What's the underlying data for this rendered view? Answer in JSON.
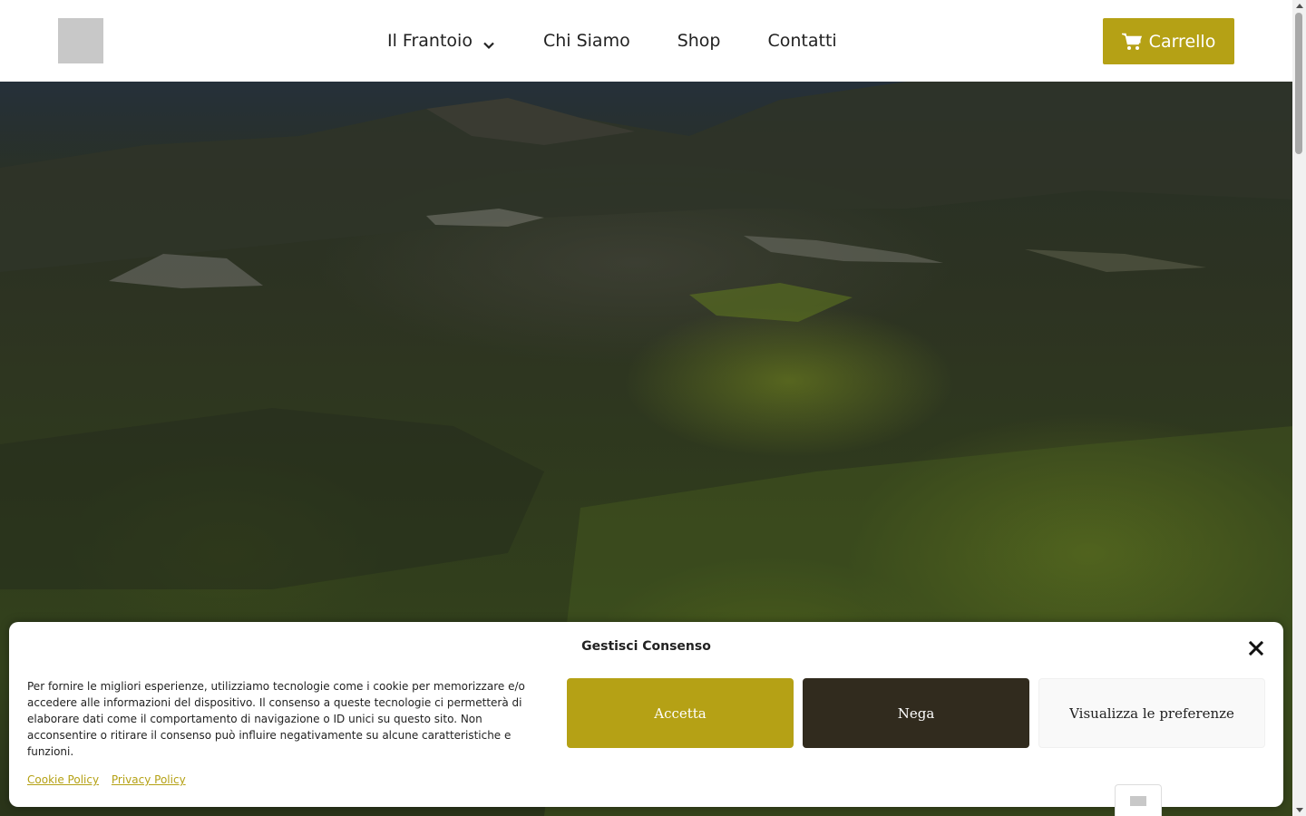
{
  "header": {
    "nav": [
      {
        "label": "Il Frantoio",
        "has_dropdown": true
      },
      {
        "label": "Chi Siamo"
      },
      {
        "label": "Shop"
      },
      {
        "label": "Contatti"
      }
    ],
    "cart_label": "Carrello",
    "accent_color": "#b5a115"
  },
  "cookie_banner": {
    "title": "Gestisci Consenso",
    "text": "Per fornire le migliori esperienze, utilizziamo tecnologie come i cookie per memorizzare e/o accedere alle informazioni del dispositivo. Il consenso a queste tecnologie ci permetterà di elaborare dati come il comportamento di navigazione o ID unici su questo sito. Non acconsentire o ritirare il consenso può influire negativamente su alcune caratteristiche e funzioni.",
    "accept_label": "Accetta",
    "deny_label": "Nega",
    "prefs_label": "Visualizza le preferenze",
    "links": {
      "cookie_policy": "Cookie Policy",
      "privacy_policy": "Privacy Policy"
    },
    "close_icon": "close-icon",
    "deny_color": "#312b1e"
  }
}
